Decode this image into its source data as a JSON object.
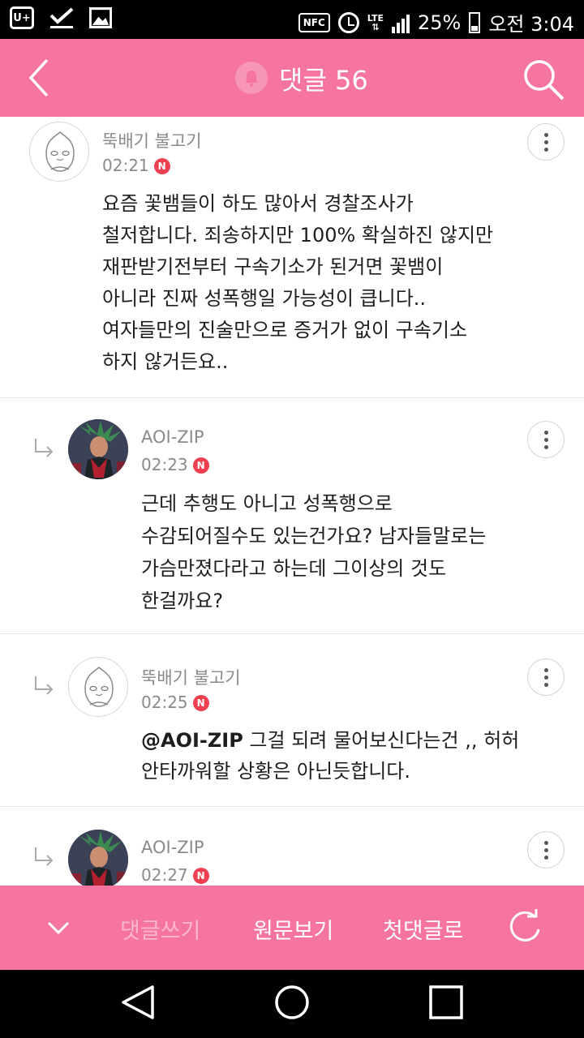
{
  "status_bar": {
    "nfc": "NFC",
    "network": "LTE",
    "battery": "25%",
    "time": "오전 3:04",
    "carrier_icon": "U+"
  },
  "header": {
    "title": "댓글 56",
    "icons": [
      "back-icon",
      "bell-icon",
      "search-icon"
    ]
  },
  "comments": [
    {
      "author": "뚝배기 불고기",
      "time": "02:21",
      "badge": "N",
      "text": "요즘 꽃뱀들이 하도 많아서 경찰조사가\n철저합니다. 죄송하지만 100% 확실하진 않지만\n재판받기전부터 구속기소가 된거면 꽃뱀이\n아니라 진짜 성폭행일 가능성이 큽니다..\n여자들만의 진술만으로 증거가 없이 구속기소\n하지 않거든요..",
      "reply": false
    },
    {
      "author": "AOI-ZIP",
      "time": "02:23",
      "badge": "N",
      "text": "근데 추행도 아니고 성폭행으로\n수감되어질수도 있는건가요? 남자들말로는\n가슴만졌다라고 하는데 그이상의 것도\n한걸까요?",
      "reply": true
    },
    {
      "author": "뚝배기 불고기",
      "time": "02:25",
      "badge": "N",
      "mention": "@AOI-ZIP",
      "text": " 그걸 되려 물어보신다는건 ,, 허허\n안타까워할 상황은 아닌듯합니다.",
      "reply": true
    },
    {
      "author": "AOI-ZIP",
      "time": "02:27",
      "badge": "N",
      "text": "",
      "reply": true
    }
  ],
  "bottom_bar": {
    "write": "댓글쓰기",
    "original": "원문보기",
    "first": "첫댓글로",
    "icons": [
      "chevron-down-icon",
      "refresh-icon"
    ]
  },
  "colors": {
    "accent": "#f5759f",
    "badge": "#f04050",
    "disabled_text": "#fbb8cd"
  }
}
